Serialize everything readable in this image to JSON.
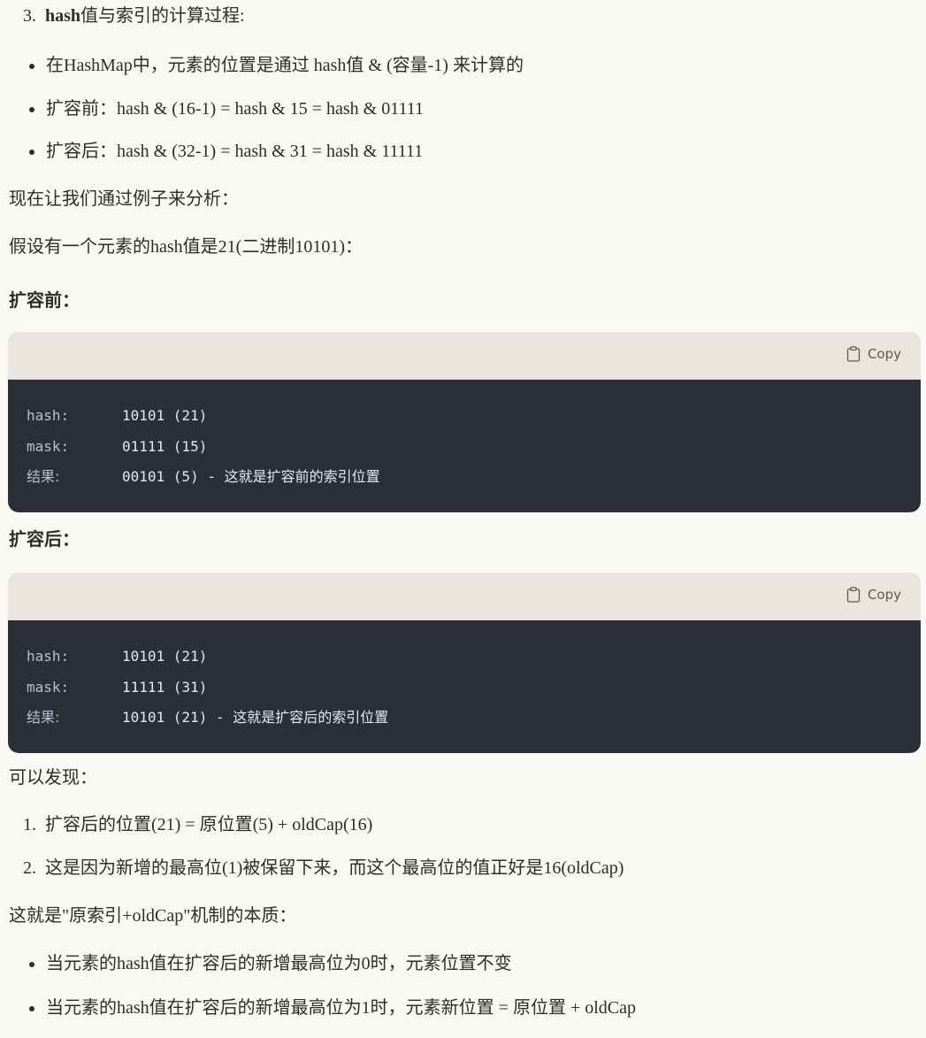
{
  "section3": {
    "number": "3.",
    "title_bold": "hash",
    "title_rest": "值与索引的计算过程:"
  },
  "bullets_top": [
    "在HashMap中，元素的位置是通过 hash值 & (容量-1) 来计算的",
    "扩容前：hash & (16-1) = hash & 15 = hash & 01111",
    "扩容后：hash & (32-1) = hash & 31 = hash & 11111"
  ],
  "para_analyze": "现在让我们通过例子来分析：",
  "para_example": "假设有一个元素的hash值是21(二进制10101)：",
  "before_label": "扩容前：",
  "after_label": "扩容后：",
  "copy_label": "Copy",
  "code_before": [
    {
      "key": "hash:",
      "val": "10101 (21)"
    },
    {
      "key": "mask:",
      "val": "01111 (15)"
    },
    {
      "key": "结果:",
      "val": "00101 (5) - 这就是扩容前的索引位置"
    }
  ],
  "code_after": [
    {
      "key": "hash:",
      "val": "10101 (21)"
    },
    {
      "key": "mask:",
      "val": "11111 (31)"
    },
    {
      "key": "结果:",
      "val": "10101 (21) - 这就是扩容后的索引位置"
    }
  ],
  "para_found": "可以发现：",
  "findings": [
    {
      "num": "1.",
      "text": "扩容后的位置(21) = 原位置(5) + oldCap(16)"
    },
    {
      "num": "2.",
      "text": "这是因为新增的最高位(1)被保留下来，而这个最高位的值正好是16(oldCap)"
    }
  ],
  "para_essence": "这就是\"原索引+oldCap\"机制的本质：",
  "bullets_bottom": [
    "当元素的hash值在扩容后的新增最高位为0时，元素位置不变",
    "当元素的hash值在扩容后的新增最高位为1时，元素新位置 = 原位置 + oldCap"
  ],
  "icons": {
    "copy": "clipboard-icon"
  }
}
